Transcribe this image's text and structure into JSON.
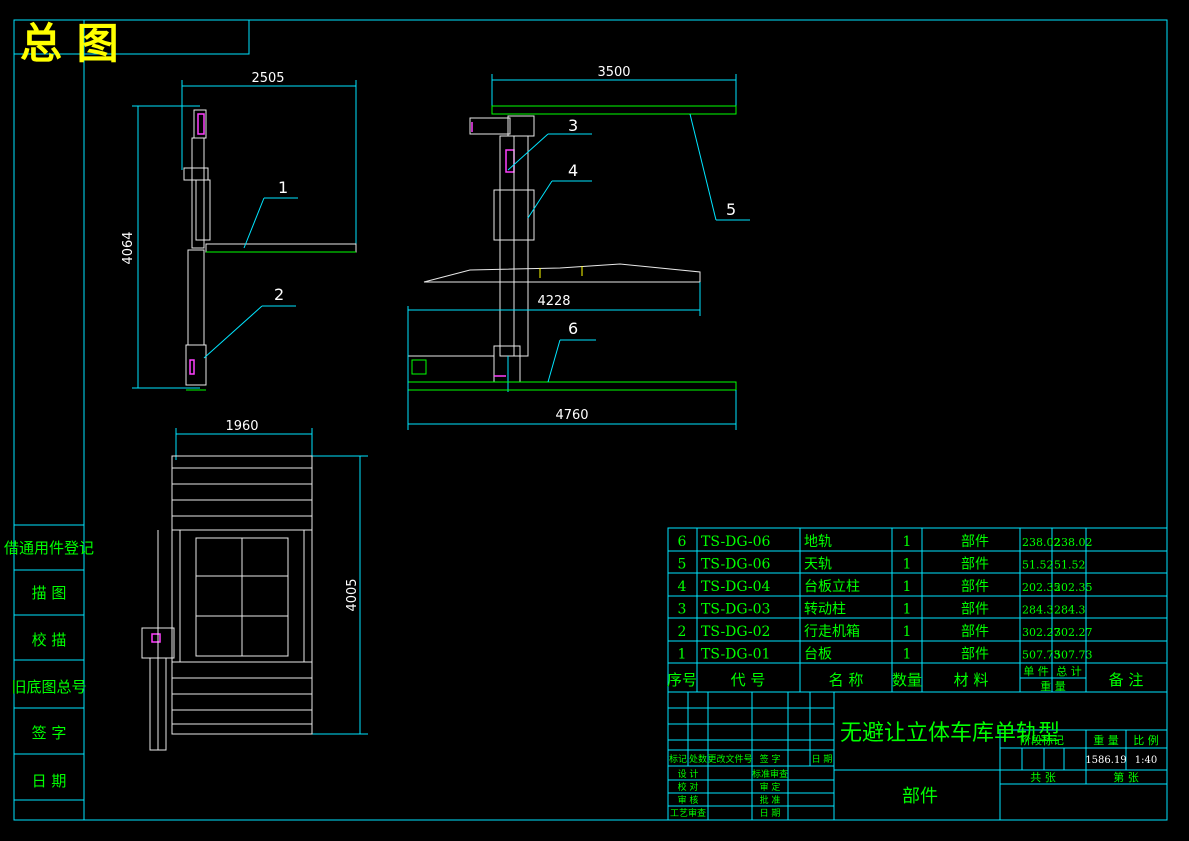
{
  "title": "总 图",
  "dimensions": {
    "side_width": "2505",
    "side_height": "4064",
    "top_rail": "3500",
    "mid_span": "4228",
    "bottom_rail": "4760",
    "plan_width": "1960",
    "plan_length": "4005"
  },
  "callouts": [
    "1",
    "2",
    "3",
    "4",
    "5",
    "6"
  ],
  "left_column": [
    "借通用件登记",
    "描 图",
    "校 描",
    "旧底图总号",
    "签 字",
    "日 期"
  ],
  "bom_rows": [
    {
      "no": "6",
      "code": "TS-DG-06",
      "name": "地轨",
      "qty": "1",
      "material": "部件",
      "unit_wt": "238.02",
      "total_wt": "238.02"
    },
    {
      "no": "5",
      "code": "TS-DG-06",
      "name": "天轨",
      "qty": "1",
      "material": "部件",
      "unit_wt": "51.52",
      "total_wt": "51.52"
    },
    {
      "no": "4",
      "code": "TS-DG-04",
      "name": "台板立柱",
      "qty": "1",
      "material": "部件",
      "unit_wt": "202.35",
      "total_wt": "202.35"
    },
    {
      "no": "3",
      "code": "TS-DG-03",
      "name": "转动柱",
      "qty": "1",
      "material": "部件",
      "unit_wt": "284.3",
      "total_wt": "284.3"
    },
    {
      "no": "2",
      "code": "TS-DG-02",
      "name": "行走机箱",
      "qty": "1",
      "material": "部件",
      "unit_wt": "302.27",
      "total_wt": "302.27"
    },
    {
      "no": "1",
      "code": "TS-DG-01",
      "name": "台板",
      "qty": "1",
      "material": "部件",
      "unit_wt": "507.73",
      "total_wt": "507.73"
    }
  ],
  "bom_header": {
    "no": "序号",
    "code": "代 号",
    "name": "名 称",
    "qty": "数量",
    "material": "材 料",
    "unit": "单 件",
    "total": "总 计",
    "weight": "重 量",
    "remark": "备 注"
  },
  "title_block": {
    "drawing_name": "无避让立体车库单轨型",
    "part_label": "部件",
    "stage_label": "阶段标记",
    "weight_label": "重 量",
    "scale_label": "比 例",
    "weight_value": "1586.19",
    "scale_value": "1:40",
    "sheets_total": "共 张",
    "sheet_no": "第 张",
    "rev_headers": [
      "标记",
      "处数",
      "更改文件号",
      "签 字",
      "日 期"
    ],
    "sign_rows_left": [
      "设 计",
      "校 对",
      "审 核",
      "工艺审查"
    ],
    "sign_rows_right": [
      "标准审查",
      "审 定",
      "批 准",
      "日 期"
    ]
  },
  "colors": {
    "line_cyan": "#00e5ff",
    "line_green": "#00ff00",
    "text_yellow": "#ffff00",
    "accent_magenta": "#ff40ff",
    "background": "#000000"
  }
}
